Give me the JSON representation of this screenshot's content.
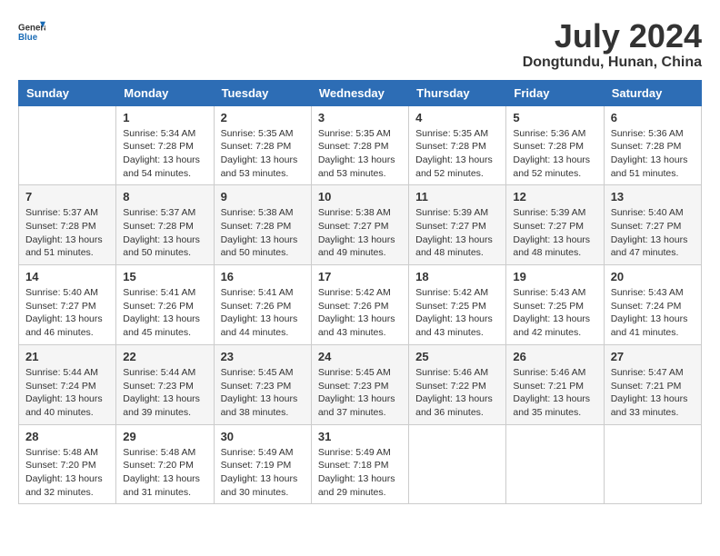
{
  "header": {
    "logo_general": "General",
    "logo_blue": "Blue",
    "month_year": "July 2024",
    "location": "Dongtundu, Hunan, China"
  },
  "weekdays": [
    "Sunday",
    "Monday",
    "Tuesday",
    "Wednesday",
    "Thursday",
    "Friday",
    "Saturday"
  ],
  "weeks": [
    [
      {
        "day": "",
        "sunrise": "",
        "sunset": "",
        "daylight": ""
      },
      {
        "day": "1",
        "sunrise": "Sunrise: 5:34 AM",
        "sunset": "Sunset: 7:28 PM",
        "daylight": "Daylight: 13 hours and 54 minutes."
      },
      {
        "day": "2",
        "sunrise": "Sunrise: 5:35 AM",
        "sunset": "Sunset: 7:28 PM",
        "daylight": "Daylight: 13 hours and 53 minutes."
      },
      {
        "day": "3",
        "sunrise": "Sunrise: 5:35 AM",
        "sunset": "Sunset: 7:28 PM",
        "daylight": "Daylight: 13 hours and 53 minutes."
      },
      {
        "day": "4",
        "sunrise": "Sunrise: 5:35 AM",
        "sunset": "Sunset: 7:28 PM",
        "daylight": "Daylight: 13 hours and 52 minutes."
      },
      {
        "day": "5",
        "sunrise": "Sunrise: 5:36 AM",
        "sunset": "Sunset: 7:28 PM",
        "daylight": "Daylight: 13 hours and 52 minutes."
      },
      {
        "day": "6",
        "sunrise": "Sunrise: 5:36 AM",
        "sunset": "Sunset: 7:28 PM",
        "daylight": "Daylight: 13 hours and 51 minutes."
      }
    ],
    [
      {
        "day": "7",
        "sunrise": "Sunrise: 5:37 AM",
        "sunset": "Sunset: 7:28 PM",
        "daylight": "Daylight: 13 hours and 51 minutes."
      },
      {
        "day": "8",
        "sunrise": "Sunrise: 5:37 AM",
        "sunset": "Sunset: 7:28 PM",
        "daylight": "Daylight: 13 hours and 50 minutes."
      },
      {
        "day": "9",
        "sunrise": "Sunrise: 5:38 AM",
        "sunset": "Sunset: 7:28 PM",
        "daylight": "Daylight: 13 hours and 50 minutes."
      },
      {
        "day": "10",
        "sunrise": "Sunrise: 5:38 AM",
        "sunset": "Sunset: 7:27 PM",
        "daylight": "Daylight: 13 hours and 49 minutes."
      },
      {
        "day": "11",
        "sunrise": "Sunrise: 5:39 AM",
        "sunset": "Sunset: 7:27 PM",
        "daylight": "Daylight: 13 hours and 48 minutes."
      },
      {
        "day": "12",
        "sunrise": "Sunrise: 5:39 AM",
        "sunset": "Sunset: 7:27 PM",
        "daylight": "Daylight: 13 hours and 48 minutes."
      },
      {
        "day": "13",
        "sunrise": "Sunrise: 5:40 AM",
        "sunset": "Sunset: 7:27 PM",
        "daylight": "Daylight: 13 hours and 47 minutes."
      }
    ],
    [
      {
        "day": "14",
        "sunrise": "Sunrise: 5:40 AM",
        "sunset": "Sunset: 7:27 PM",
        "daylight": "Daylight: 13 hours and 46 minutes."
      },
      {
        "day": "15",
        "sunrise": "Sunrise: 5:41 AM",
        "sunset": "Sunset: 7:26 PM",
        "daylight": "Daylight: 13 hours and 45 minutes."
      },
      {
        "day": "16",
        "sunrise": "Sunrise: 5:41 AM",
        "sunset": "Sunset: 7:26 PM",
        "daylight": "Daylight: 13 hours and 44 minutes."
      },
      {
        "day": "17",
        "sunrise": "Sunrise: 5:42 AM",
        "sunset": "Sunset: 7:26 PM",
        "daylight": "Daylight: 13 hours and 43 minutes."
      },
      {
        "day": "18",
        "sunrise": "Sunrise: 5:42 AM",
        "sunset": "Sunset: 7:25 PM",
        "daylight": "Daylight: 13 hours and 43 minutes."
      },
      {
        "day": "19",
        "sunrise": "Sunrise: 5:43 AM",
        "sunset": "Sunset: 7:25 PM",
        "daylight": "Daylight: 13 hours and 42 minutes."
      },
      {
        "day": "20",
        "sunrise": "Sunrise: 5:43 AM",
        "sunset": "Sunset: 7:24 PM",
        "daylight": "Daylight: 13 hours and 41 minutes."
      }
    ],
    [
      {
        "day": "21",
        "sunrise": "Sunrise: 5:44 AM",
        "sunset": "Sunset: 7:24 PM",
        "daylight": "Daylight: 13 hours and 40 minutes."
      },
      {
        "day": "22",
        "sunrise": "Sunrise: 5:44 AM",
        "sunset": "Sunset: 7:23 PM",
        "daylight": "Daylight: 13 hours and 39 minutes."
      },
      {
        "day": "23",
        "sunrise": "Sunrise: 5:45 AM",
        "sunset": "Sunset: 7:23 PM",
        "daylight": "Daylight: 13 hours and 38 minutes."
      },
      {
        "day": "24",
        "sunrise": "Sunrise: 5:45 AM",
        "sunset": "Sunset: 7:23 PM",
        "daylight": "Daylight: 13 hours and 37 minutes."
      },
      {
        "day": "25",
        "sunrise": "Sunrise: 5:46 AM",
        "sunset": "Sunset: 7:22 PM",
        "daylight": "Daylight: 13 hours and 36 minutes."
      },
      {
        "day": "26",
        "sunrise": "Sunrise: 5:46 AM",
        "sunset": "Sunset: 7:21 PM",
        "daylight": "Daylight: 13 hours and 35 minutes."
      },
      {
        "day": "27",
        "sunrise": "Sunrise: 5:47 AM",
        "sunset": "Sunset: 7:21 PM",
        "daylight": "Daylight: 13 hours and 33 minutes."
      }
    ],
    [
      {
        "day": "28",
        "sunrise": "Sunrise: 5:48 AM",
        "sunset": "Sunset: 7:20 PM",
        "daylight": "Daylight: 13 hours and 32 minutes."
      },
      {
        "day": "29",
        "sunrise": "Sunrise: 5:48 AM",
        "sunset": "Sunset: 7:20 PM",
        "daylight": "Daylight: 13 hours and 31 minutes."
      },
      {
        "day": "30",
        "sunrise": "Sunrise: 5:49 AM",
        "sunset": "Sunset: 7:19 PM",
        "daylight": "Daylight: 13 hours and 30 minutes."
      },
      {
        "day": "31",
        "sunrise": "Sunrise: 5:49 AM",
        "sunset": "Sunset: 7:18 PM",
        "daylight": "Daylight: 13 hours and 29 minutes."
      },
      {
        "day": "",
        "sunrise": "",
        "sunset": "",
        "daylight": ""
      },
      {
        "day": "",
        "sunrise": "",
        "sunset": "",
        "daylight": ""
      },
      {
        "day": "",
        "sunrise": "",
        "sunset": "",
        "daylight": ""
      }
    ]
  ]
}
